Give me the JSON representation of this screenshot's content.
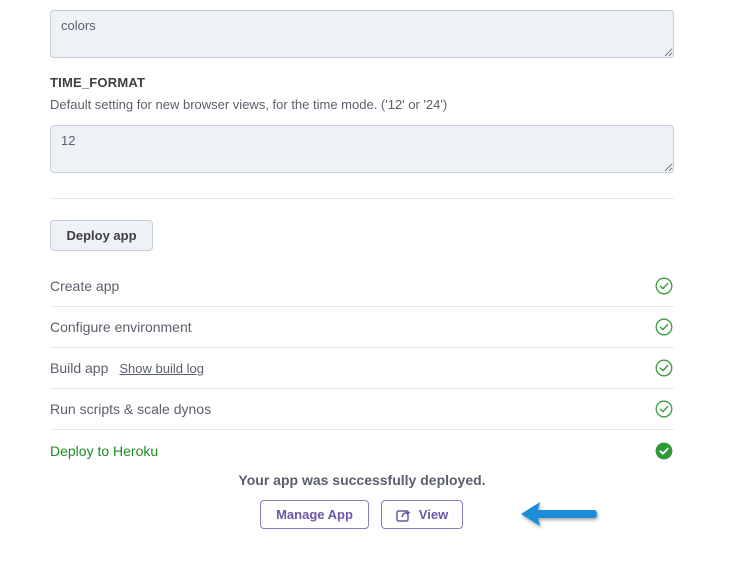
{
  "config": {
    "colors_field": {
      "value": "colors"
    },
    "time_format": {
      "label": "TIME_FORMAT",
      "description": "Default setting for new browser views, for the time mode. ('12' or '24')",
      "value": "12"
    }
  },
  "deploy_button_label": "Deploy app",
  "steps": [
    {
      "label": "Create app",
      "status": "done"
    },
    {
      "label": "Configure environment",
      "status": "done"
    },
    {
      "label": "Build app",
      "link": "Show build log",
      "status": "done"
    },
    {
      "label": "Run scripts & scale dynos",
      "status": "done"
    },
    {
      "label": "Deploy to Heroku",
      "status": "complete"
    }
  ],
  "result": {
    "message": "Your app was successfully deployed.",
    "manage_label": "Manage App",
    "view_label": "View"
  },
  "colors": {
    "success_green": "#1f8a23",
    "check_outline": "#3a9a3e",
    "button_purple": "#6a57a8",
    "annotation_arrow": "#1a8ed6"
  },
  "icons": [
    "check-circle-outline-icon",
    "check-circle-filled-icon",
    "external-link-icon",
    "annotation-arrow"
  ]
}
